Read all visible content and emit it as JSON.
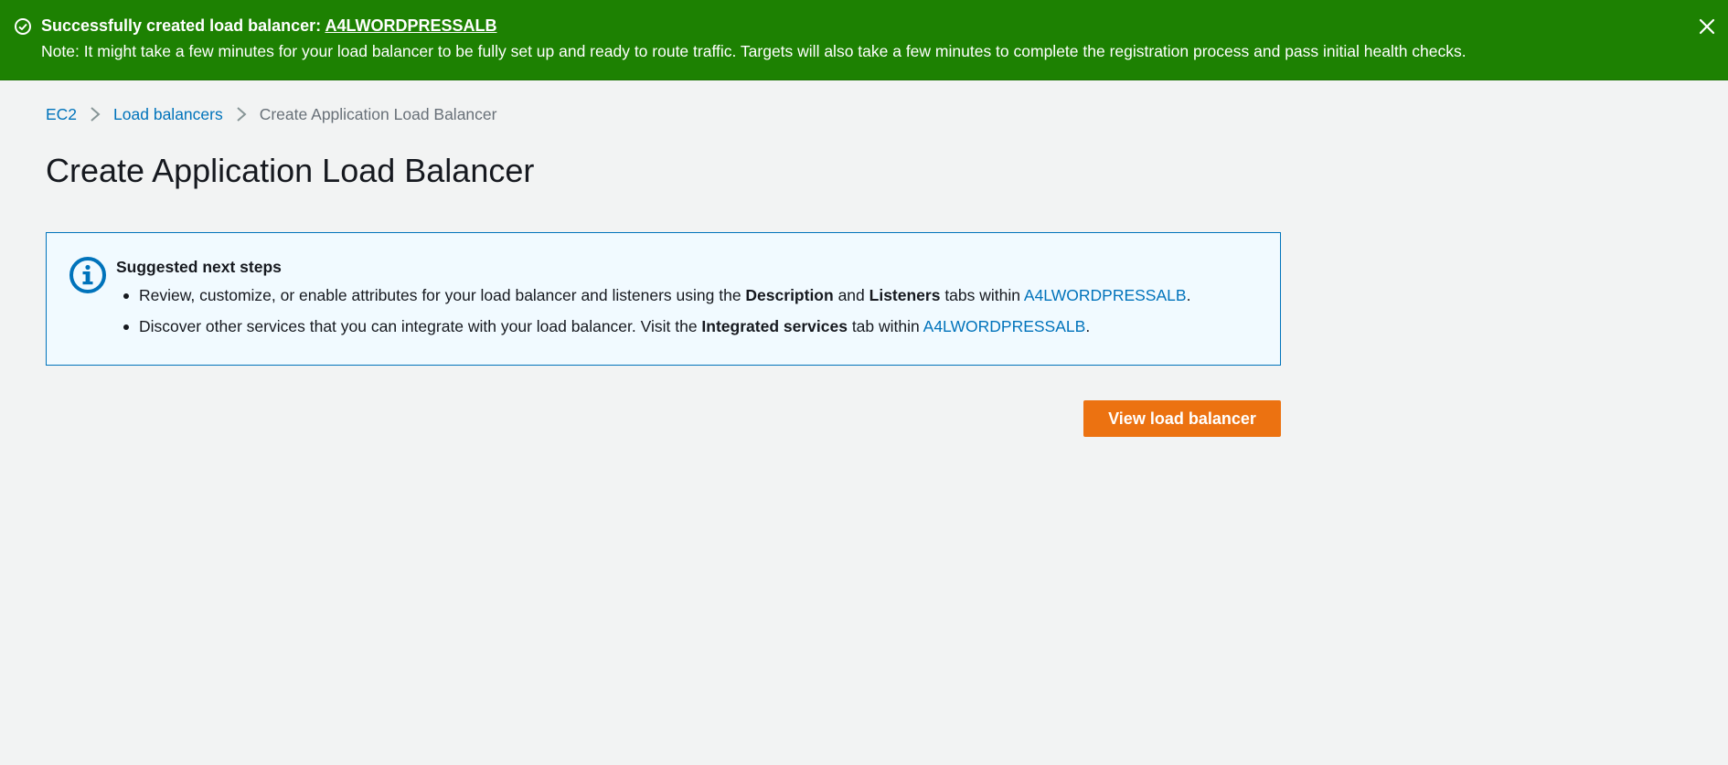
{
  "flash": {
    "title_prefix": "Successfully created load balancer: ",
    "lb_name": "A4LWORDPRESSALB",
    "note": "Note: It might take a few minutes for your load balancer to be fully set up and ready to route traffic. Targets will also take a few minutes to complete the registration process and pass initial health checks.",
    "color": "#1d8102"
  },
  "breadcrumb": {
    "items": [
      {
        "label": "EC2"
      },
      {
        "label": "Load balancers"
      },
      {
        "label": "Create Application Load Balancer"
      }
    ]
  },
  "page": {
    "title": "Create Application Load Balancer"
  },
  "info": {
    "title": "Suggested next steps",
    "item1": {
      "t1": "Review, customize, or enable attributes for your load balancer and listeners using the ",
      "b1": "Description",
      "t2": " and ",
      "b2": "Listeners",
      "t3": " tabs within ",
      "link": "A4LWORDPRESSALB",
      "t4": "."
    },
    "item2": {
      "t1": "Discover other services that you can integrate with your load balancer. Visit the ",
      "b1": "Integrated services",
      "t2": " tab within ",
      "link": "A4LWORDPRESSALB",
      "t3": "."
    }
  },
  "actions": {
    "view_label": "View load balancer",
    "accent": "#ec7211"
  }
}
